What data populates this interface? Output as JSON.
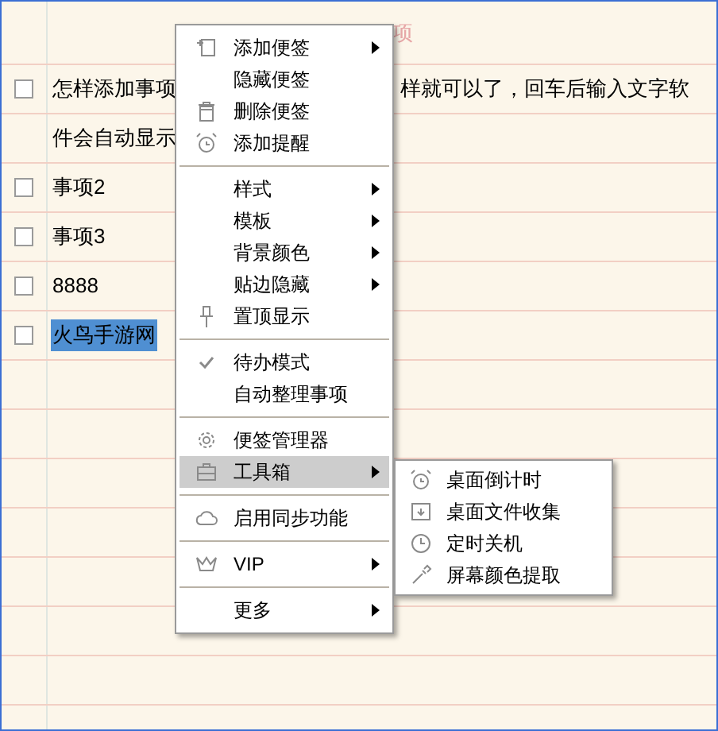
{
  "header": {
    "text": "项"
  },
  "items": [
    {
      "checked": false,
      "text": "怎样添加事项",
      "text_right": "样就可以了，回车后输入文字软",
      "selected": false
    },
    {
      "kind": "continuation",
      "text": "件会自动显示"
    },
    {
      "checked": false,
      "text": "事项2",
      "selected": false
    },
    {
      "checked": false,
      "text": "事项3",
      "selected": false
    },
    {
      "checked": false,
      "text": "8888",
      "selected": false
    },
    {
      "checked": false,
      "text": "火鸟手游网",
      "selected": true
    }
  ],
  "context_menu": {
    "groups": [
      [
        {
          "label": "添加便签",
          "submenu": true,
          "checked": false,
          "selected": false
        },
        {
          "label": "隐藏便签",
          "submenu": false,
          "checked": false,
          "selected": false
        },
        {
          "label": "删除便签",
          "submenu": false,
          "checked": false,
          "selected": false
        },
        {
          "label": "添加提醒",
          "submenu": false,
          "checked": false,
          "selected": false
        }
      ],
      [
        {
          "label": "样式",
          "submenu": true,
          "checked": false,
          "selected": false
        },
        {
          "label": "模板",
          "submenu": true,
          "checked": false,
          "selected": false
        },
        {
          "label": "背景颜色",
          "submenu": true,
          "checked": false,
          "selected": false
        },
        {
          "label": "贴边隐藏",
          "submenu": true,
          "checked": false,
          "selected": false
        },
        {
          "label": "置顶显示",
          "submenu": false,
          "checked": false,
          "selected": false
        }
      ],
      [
        {
          "label": "待办模式",
          "submenu": false,
          "checked": true,
          "selected": false
        },
        {
          "label": "自动整理事项",
          "submenu": false,
          "checked": false,
          "selected": false
        }
      ],
      [
        {
          "label": "便签管理器",
          "submenu": false,
          "checked": false,
          "selected": false
        },
        {
          "label": "工具箱",
          "submenu": true,
          "checked": false,
          "selected": true
        }
      ],
      [
        {
          "label": "启用同步功能",
          "submenu": false,
          "checked": false,
          "selected": false
        }
      ],
      [
        {
          "label": "VIP",
          "submenu": true,
          "checked": false,
          "selected": false
        }
      ],
      [
        {
          "label": "更多",
          "submenu": true,
          "checked": false,
          "selected": false
        }
      ]
    ]
  },
  "submenu": {
    "items": [
      {
        "label": "桌面倒计时"
      },
      {
        "label": "桌面文件收集"
      },
      {
        "label": "定时关机"
      },
      {
        "label": "屏幕颜色提取"
      }
    ]
  }
}
